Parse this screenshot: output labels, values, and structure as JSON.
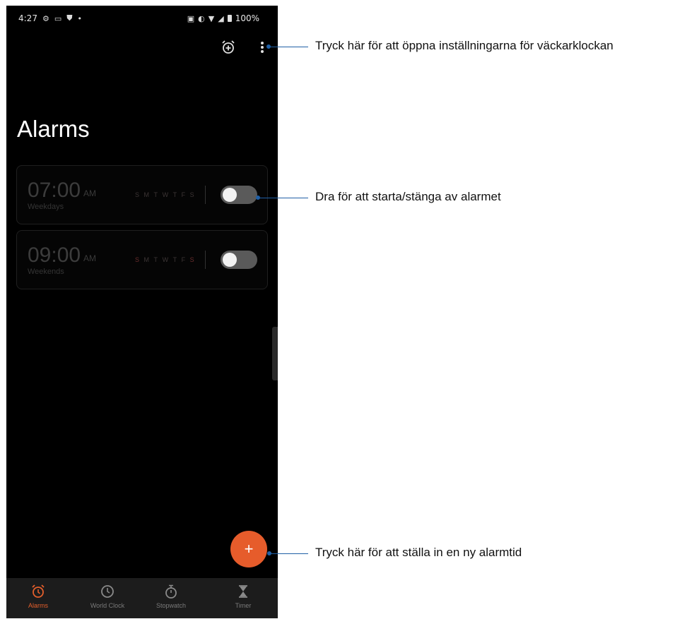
{
  "status_bar": {
    "time": "4:27",
    "battery": "100%",
    "left_icons": [
      "gear-icon",
      "gallery-icon",
      "shield-icon",
      "dot-icon"
    ],
    "right_icons": [
      "nfc-icon",
      "data-saver-icon",
      "wifi-icon",
      "signal-icon",
      "battery-icon"
    ]
  },
  "toolbar": {
    "icons": [
      "alarm-add-icon",
      "more-vert-icon"
    ]
  },
  "page": {
    "title": "Alarms"
  },
  "alarms": [
    {
      "time": "07:00",
      "ampm": "AM",
      "label": "Weekdays",
      "days": [
        "S",
        "M",
        "T",
        "W",
        "T",
        "F",
        "S"
      ],
      "enabled": false
    },
    {
      "time": "09:00",
      "ampm": "AM",
      "label": "Weekends",
      "days": [
        "S",
        "M",
        "T",
        "W",
        "T",
        "F",
        "S"
      ],
      "enabled": false
    }
  ],
  "fab": {
    "label": "+"
  },
  "tabs": [
    {
      "label": "Alarms",
      "icon": "alarm-clock-icon",
      "active": true
    },
    {
      "label": "World Clock",
      "icon": "clock-icon",
      "active": false
    },
    {
      "label": "Stopwatch",
      "icon": "stopwatch-icon",
      "active": false
    },
    {
      "label": "Timer",
      "icon": "hourglass-icon",
      "active": false
    }
  ],
  "annotations": {
    "settings": "Tryck här för att öppna inställningarna för väckarklockan",
    "toggle": "Dra för att starta/stänga av alarmet",
    "new_alarm": "Tryck här för att ställa in en ny alarmtid"
  },
  "colors": {
    "accent": "#e65c2b",
    "leader_line": "#1f5fa5",
    "background": "#000000"
  }
}
